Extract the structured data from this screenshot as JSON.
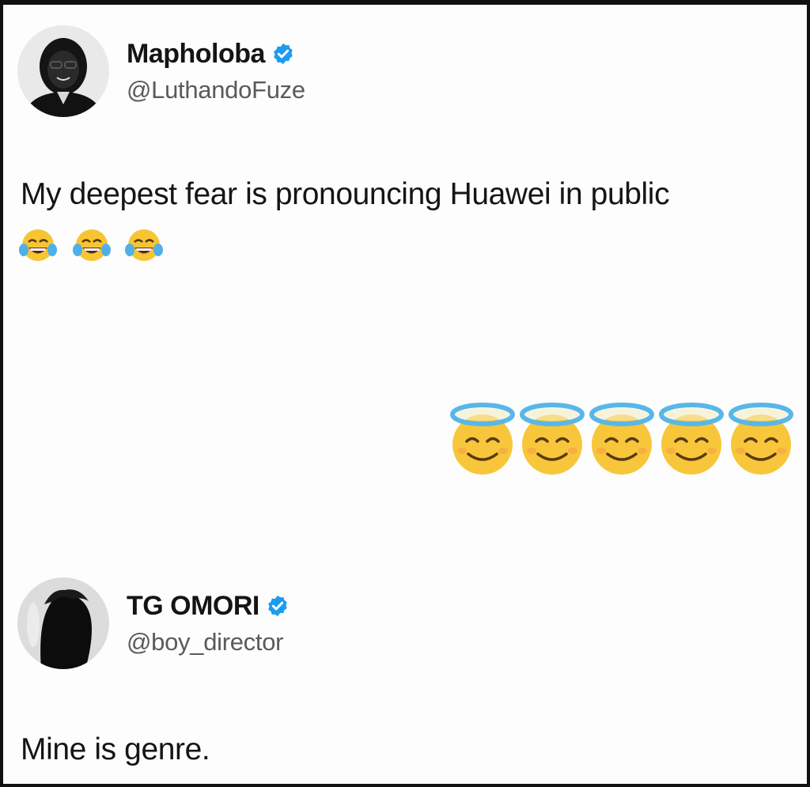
{
  "tweet1": {
    "display_name": "Mapholoba",
    "handle": "@LuthandoFuze",
    "text": "My deepest fear is pronouncing Huawei in public",
    "emojis": [
      "face-with-tears-of-joy",
      "face-with-tears-of-joy",
      "face-with-tears-of-joy"
    ]
  },
  "standalone_emojis": [
    "smiling-face-with-halo",
    "smiling-face-with-halo",
    "smiling-face-with-halo",
    "smiling-face-with-halo",
    "smiling-face-with-halo"
  ],
  "tweet2": {
    "display_name": "TG OMORI",
    "handle": "@boy_director",
    "text": "Mine is genre."
  },
  "colors": {
    "verified": "#1d9bf0",
    "background": "#fdfdfd",
    "text": "#151515",
    "handle": "#5a5a5a"
  }
}
